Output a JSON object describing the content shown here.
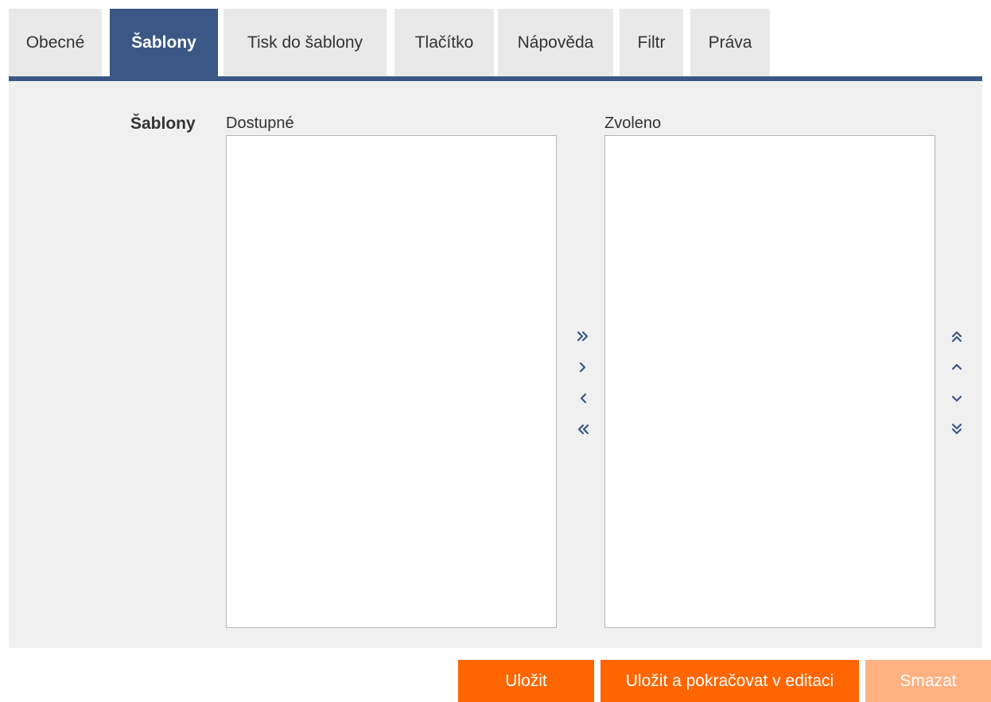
{
  "tabs": [
    {
      "label": "Obecné",
      "active": false
    },
    {
      "label": "Šablony",
      "active": true
    },
    {
      "label": "Tisk do šablony",
      "active": false
    },
    {
      "label": "Tlačítko",
      "active": false
    },
    {
      "label": "Nápověda",
      "active": false
    },
    {
      "label": "Filtr",
      "active": false
    },
    {
      "label": "Práva",
      "active": false
    }
  ],
  "form": {
    "field_label": "Šablony",
    "available_label": "Dostupné",
    "selected_label": "Zvoleno",
    "available_items": [],
    "selected_items": []
  },
  "transfer_controls": [
    "move-all-right-icon",
    "move-right-icon",
    "move-left-icon",
    "move-all-left-icon"
  ],
  "order_controls": [
    "move-top-icon",
    "move-up-icon",
    "move-down-icon",
    "move-bottom-icon"
  ],
  "buttons": {
    "save": "Uložit",
    "save_continue": "Uložit a pokračovat v editaci",
    "delete": "Smazat"
  },
  "colors": {
    "accent": "#3a5786",
    "primary_button": "#ff6600",
    "disabled_button": "#ffb182",
    "panel_bg": "#f0f0f0",
    "tab_bg": "#e9e9e9"
  }
}
